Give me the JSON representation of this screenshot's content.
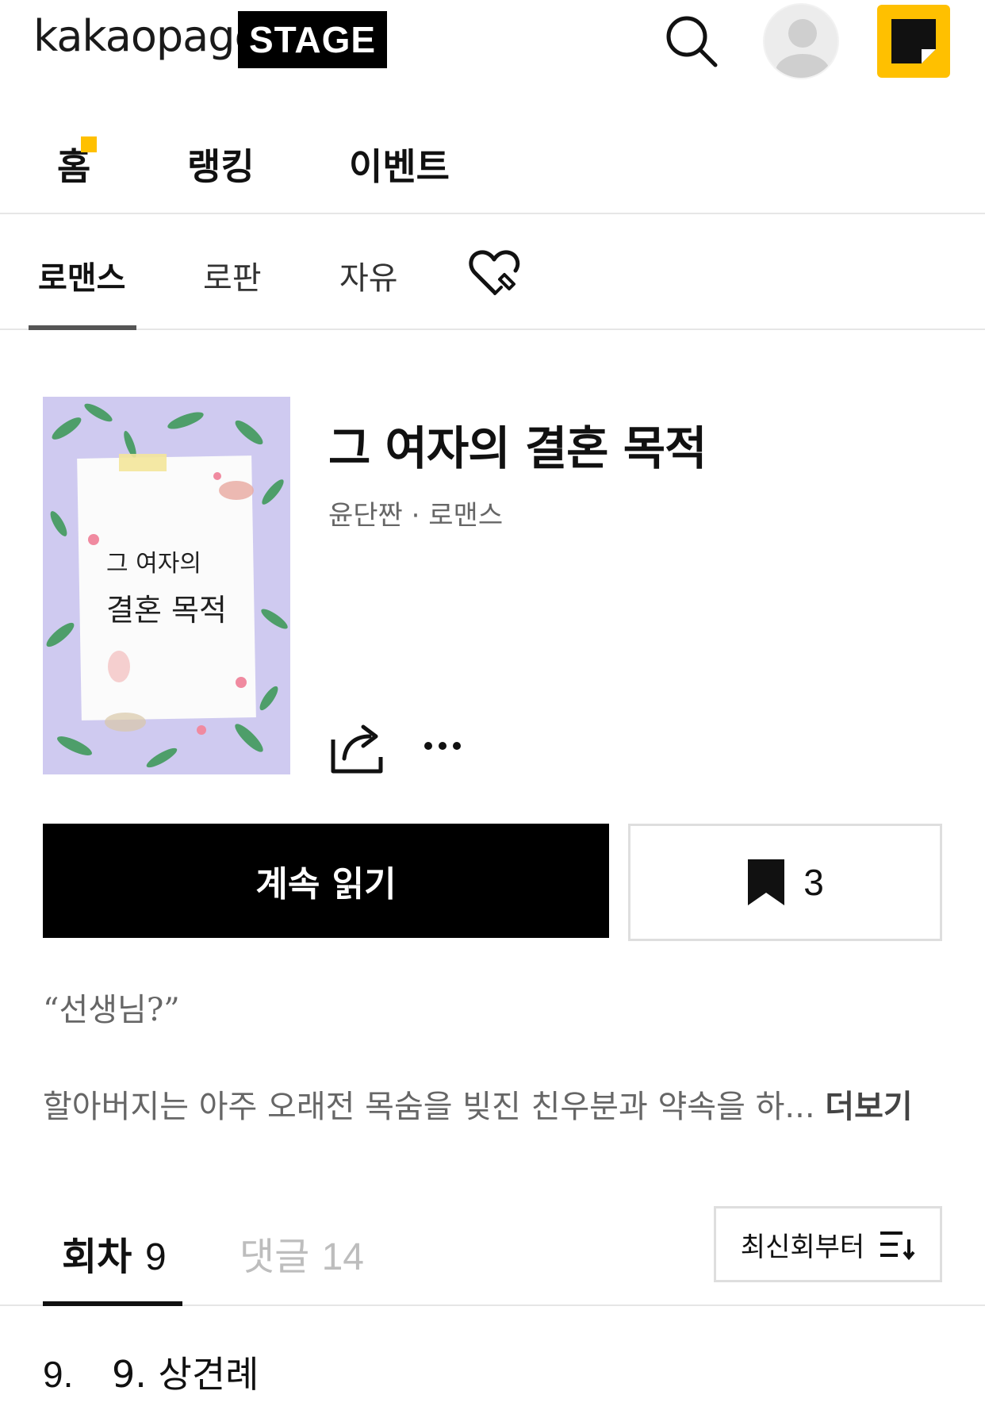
{
  "header": {
    "logo_word": "kakaopage",
    "logo_badge": "STAGE",
    "search_icon": "search-icon",
    "avatar_icon": "user-avatar-icon",
    "app_icon": "kakaopage-app-icon",
    "accent_color": "#ffc000"
  },
  "main_nav": {
    "items": [
      {
        "label": "홈",
        "has_new_dot": true
      },
      {
        "label": "랭킹"
      },
      {
        "label": "이벤트"
      }
    ]
  },
  "genre_nav": {
    "tabs": [
      {
        "label": "로맨스",
        "active": true
      },
      {
        "label": "로판",
        "active": false
      },
      {
        "label": "자유",
        "active": false
      }
    ],
    "favorites_icon": "heart-pin-icon"
  },
  "work": {
    "cover_title_line1": "그 여자의",
    "cover_title_line2": "결혼 목적",
    "title": "그 여자의 결혼 목적",
    "meta": "윤단짠 · 로맨스",
    "share_icon": "share-icon",
    "more_icon": "more-icon"
  },
  "actions": {
    "continue_label": "계속 읽기",
    "bookmark_icon": "bookmark-icon",
    "bookmark_count": "3"
  },
  "synopsis": {
    "quote": "“선생님?”",
    "text": "할아버지는 아주 오래전 목숨을 빚진 친우분과 약속을 하...",
    "more_label": "더보기"
  },
  "episodes": {
    "tabs": [
      {
        "label": "회차",
        "count": "9",
        "active": true
      },
      {
        "label": "댓글",
        "count": "14",
        "active": false
      }
    ],
    "sort_label": "최신회부터",
    "sort_icon": "sort-icon",
    "rows": [
      {
        "number": "9.",
        "title": "9. 상견례"
      }
    ]
  }
}
